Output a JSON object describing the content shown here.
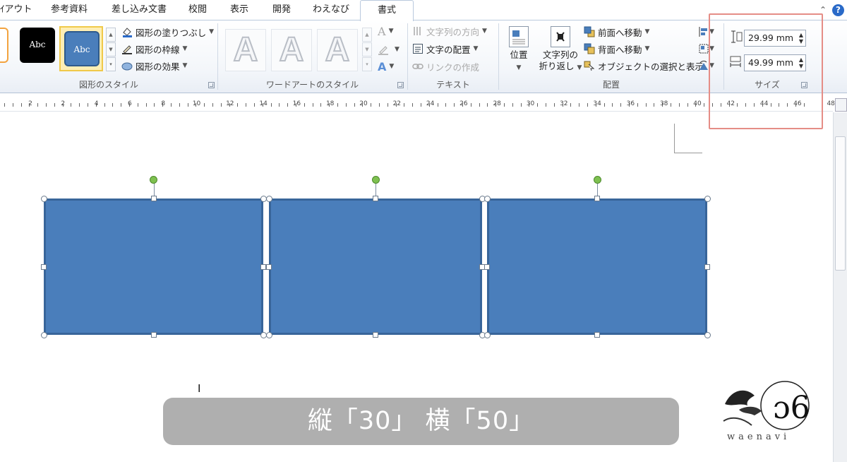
{
  "tabs": [
    {
      "label": "ｲアウト",
      "active": false
    },
    {
      "label": "参考資料",
      "active": false
    },
    {
      "label": "差し込み文書",
      "active": false
    },
    {
      "label": "校閲",
      "active": false
    },
    {
      "label": "表示",
      "active": false
    },
    {
      "label": "開発",
      "active": false
    },
    {
      "label": "わえなび",
      "active": false
    },
    {
      "label": "書式",
      "active": true
    }
  ],
  "ribbon": {
    "shape_styles": {
      "label": "図形のスタイル",
      "swatch_text": "Abc",
      "fill_label": "図形の塗りつぶし",
      "outline_label": "図形の枠線",
      "effects_label": "図形の効果"
    },
    "wordart": {
      "label": "ワードアートのスタイル",
      "letter": "A",
      "letter_small": "A"
    },
    "text": {
      "label": "テキスト",
      "direction_label": "文字列の方向",
      "align_label": "文字の配置",
      "link_label": "リンクの作成"
    },
    "arrange": {
      "label": "配置",
      "position_label": "位置",
      "wrap_label_1": "文字列の",
      "wrap_label_2": "折り返し",
      "front_label": "前面へ移動",
      "back_label": "背面へ移動",
      "select_label": "オブジェクトの選択と表示"
    },
    "size": {
      "label": "サイズ",
      "height_value": "29.99 mm",
      "width_value": "49.99 mm"
    }
  },
  "ruler": {
    "numbers": [
      "2",
      "2",
      "4",
      "6",
      "8",
      "10",
      "12",
      "14",
      "16",
      "18",
      "20",
      "22",
      "24",
      "26",
      "28",
      "30",
      "32",
      "34",
      "36",
      "38",
      "40",
      "42",
      "44",
      "46",
      "48"
    ]
  },
  "caption": "縦「30」 横「50」",
  "logo": {
    "text": "waenavi"
  },
  "colors": {
    "shape_fill": "#4a7ebb",
    "shape_border": "#38659a",
    "highlight": "#e58d86",
    "rotation_handle": "#7ec050"
  }
}
